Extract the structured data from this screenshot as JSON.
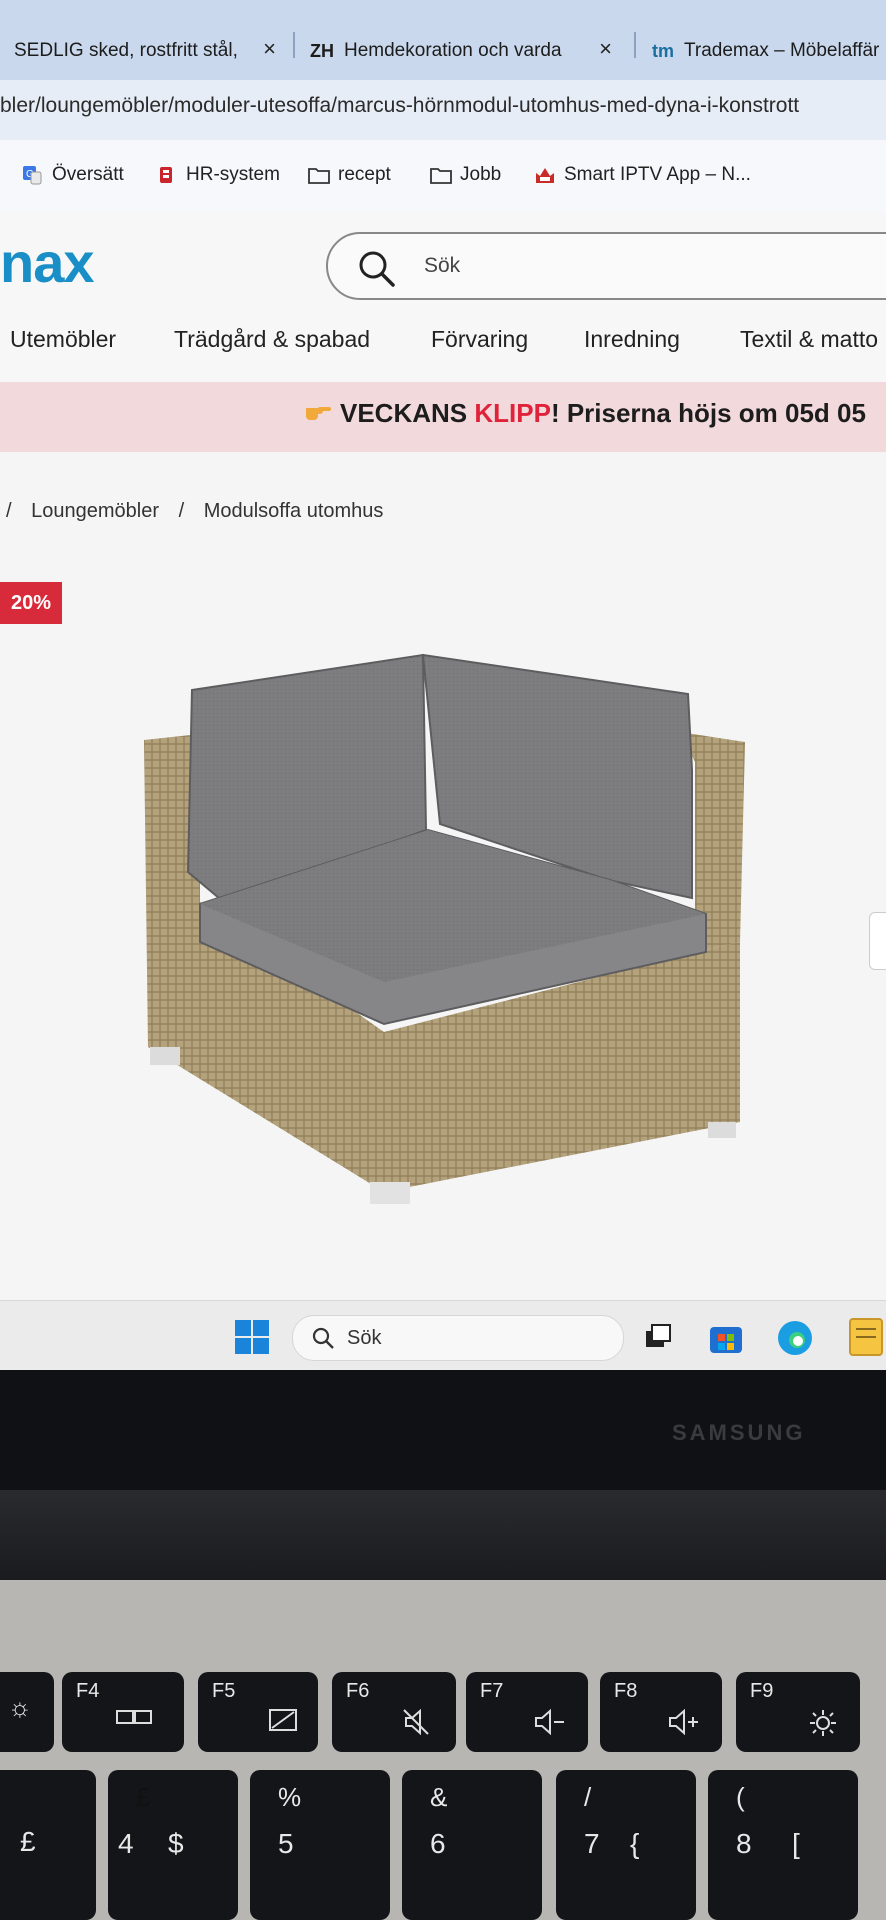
{
  "browser": {
    "tabs": [
      {
        "title": "SEDLIG sked, rostfritt stål,",
        "favicon": ""
      },
      {
        "title": "Hemdekoration och varda",
        "favicon": "ZH"
      },
      {
        "title": "Trademax – Möbelaffär",
        "favicon": "tm"
      }
    ],
    "close_glyph": "×",
    "url": "bler/loungemöbler/moduler-utesoffa/marcus-hörnmodul-utomhus-med-dyna-i-konstrott",
    "bookmarks": [
      {
        "label": "Översätt",
        "icon": "translate-icon"
      },
      {
        "label": "HR-system",
        "icon": "hr-icon"
      },
      {
        "label": "recept",
        "icon": "folder-icon"
      },
      {
        "label": "Jobb",
        "icon": "folder-icon"
      },
      {
        "label": "Smart IPTV App – N...",
        "icon": "iptv-icon"
      }
    ]
  },
  "site": {
    "logo": "nax",
    "search_placeholder": "Sök",
    "nav": [
      "Utemöbler",
      "Trädgård & spabad",
      "Förvaring",
      "Inredning",
      "Textil & matto"
    ],
    "promo": {
      "lead": "VECKANS ",
      "highlight": "KLIPP",
      "rest": "! Priserna höjs om 05d 05"
    },
    "breadcrumb": [
      "/",
      "Loungemöbler",
      "/",
      "Modulsoffa utomhus"
    ],
    "discount_badge": "20%"
  },
  "taskbar": {
    "search_label": "Sök"
  },
  "laptop": {
    "brand": "SAMSUNG",
    "fkeys": [
      "F4",
      "F5",
      "F6",
      "F7",
      "F8",
      "F9"
    ],
    "number_keys": [
      {
        "upper": "£",
        "lower": "4",
        "alt": "$"
      },
      {
        "upper": "%",
        "lower": "5",
        "alt": ""
      },
      {
        "upper": "&",
        "lower": "6",
        "alt": ""
      },
      {
        "upper": "/",
        "lower": "7",
        "alt": "{"
      },
      {
        "upper": "(",
        "lower": "8",
        "alt": "["
      }
    ]
  },
  "colors": {
    "brand_blue": "#1a8fc7",
    "sale_red": "#d72b3b",
    "promo_bg": "#f2d9dc"
  }
}
